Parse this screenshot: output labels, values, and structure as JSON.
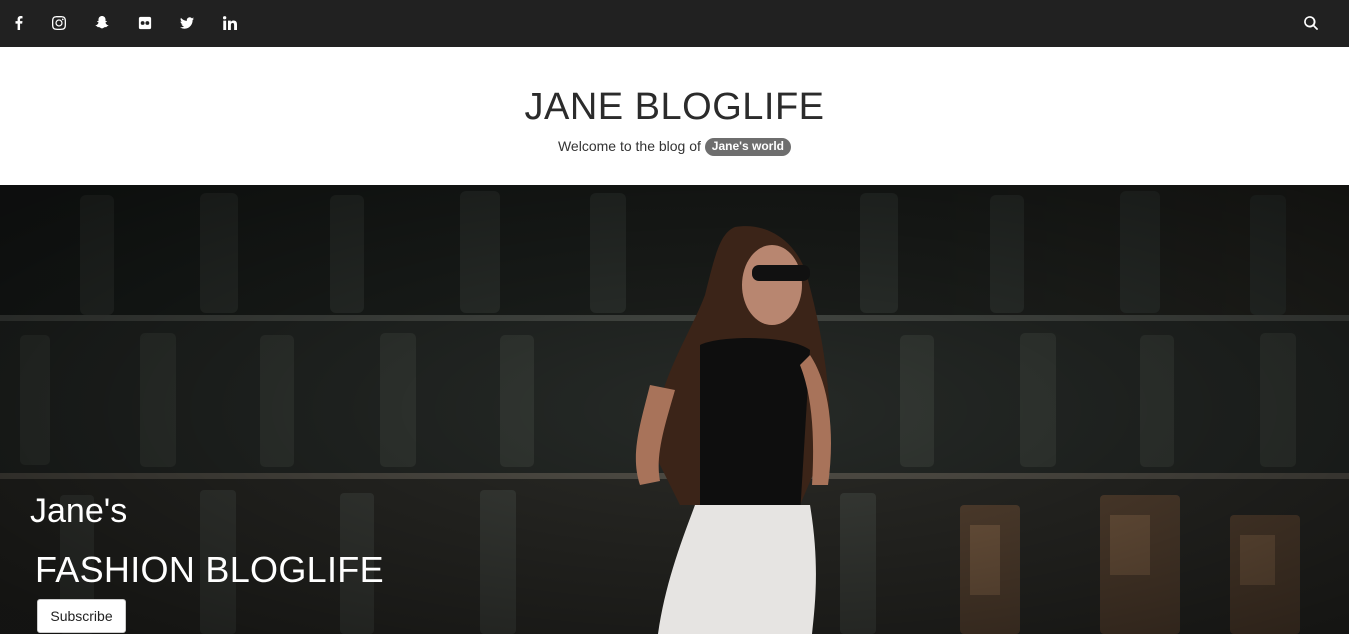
{
  "topbar": {
    "social_icons": [
      "facebook-icon",
      "instagram-icon",
      "snapchat-icon",
      "flickr-icon",
      "twitter-icon",
      "linkedin-icon"
    ],
    "search_icon": "search-icon",
    "background": "#212121"
  },
  "header": {
    "title": "JANE BLOGLIFE",
    "tagline_prefix": "Welcome to the blog of",
    "tagline_badge": "Jane's world"
  },
  "hero": {
    "heading": "Jane's",
    "subheading": "FASHION BLOGLIFE",
    "button_label": "Subscribe"
  }
}
